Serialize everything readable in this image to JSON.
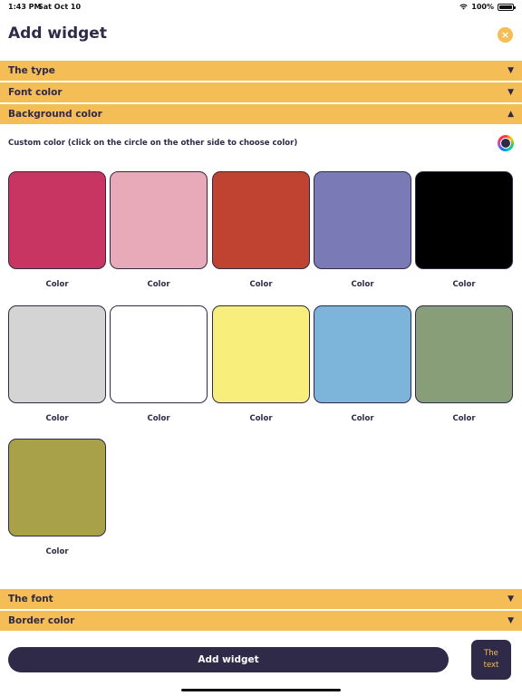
{
  "status_bar": {
    "time": "1:43 PM",
    "date": "Sat Oct 10",
    "battery": "100%"
  },
  "header": {
    "title": "Add widget",
    "close_icon": "×"
  },
  "sections": {
    "type": {
      "label": "The type",
      "chevron": "▼",
      "expanded": false
    },
    "font_color": {
      "label": "Font color",
      "chevron": "▼",
      "expanded": false
    },
    "background_color": {
      "label": "Background color",
      "chevron": "▲",
      "expanded": true
    },
    "font": {
      "label": "The font",
      "chevron": "▼",
      "expanded": false
    },
    "border_color": {
      "label": "Border color",
      "chevron": "▼",
      "expanded": false
    }
  },
  "custom_color": {
    "label": "Custom color (click on the circle on the other side to choose color)",
    "current": "#2e2a48"
  },
  "swatches": [
    {
      "color": "#c93562",
      "label": "Color"
    },
    {
      "color": "#e8a9b9",
      "label": "Color"
    },
    {
      "color": "#c04332",
      "label": "Color"
    },
    {
      "color": "#7a7ab6",
      "label": "Color"
    },
    {
      "color": "#000000",
      "label": "Color"
    },
    {
      "color": "#d4d4d4",
      "label": "Color"
    },
    {
      "color": "#ffffff",
      "label": "Color"
    },
    {
      "color": "#f8ee7c",
      "label": "Color"
    },
    {
      "color": "#7db4da",
      "label": "Color"
    },
    {
      "color": "#879e79",
      "label": "Color"
    },
    {
      "color": "#a9a04a",
      "label": "Color"
    }
  ],
  "footer": {
    "add_button_label": "Add widget",
    "preview_line1": "The",
    "preview_line2": "text"
  },
  "theme": {
    "accent": "#f4bd55",
    "dark": "#2e2a48"
  }
}
